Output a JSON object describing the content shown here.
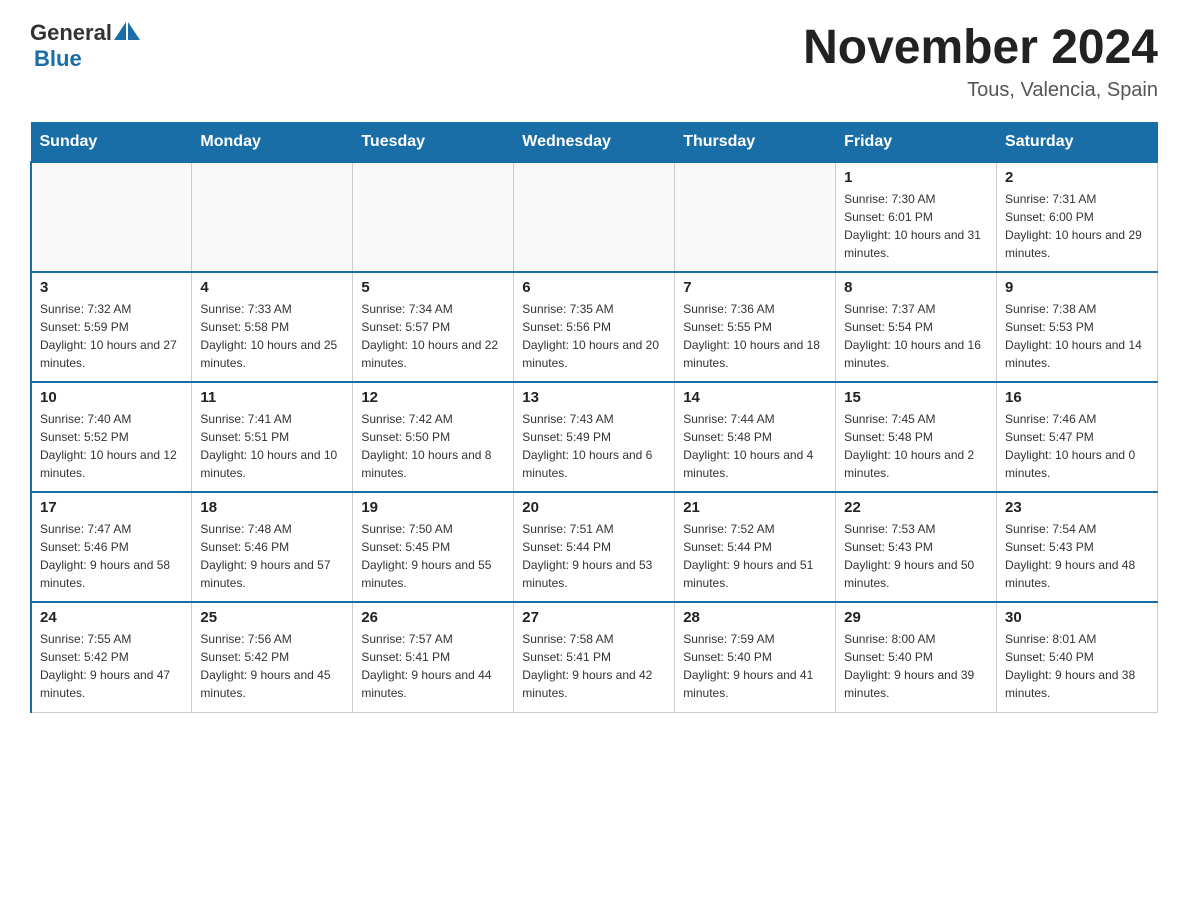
{
  "logo": {
    "text_general": "General",
    "text_blue": "Blue"
  },
  "title": "November 2024",
  "location": "Tous, Valencia, Spain",
  "days_of_week": [
    "Sunday",
    "Monday",
    "Tuesday",
    "Wednesday",
    "Thursday",
    "Friday",
    "Saturday"
  ],
  "weeks": [
    [
      {
        "day": "",
        "sunrise": "",
        "sunset": "",
        "daylight": ""
      },
      {
        "day": "",
        "sunrise": "",
        "sunset": "",
        "daylight": ""
      },
      {
        "day": "",
        "sunrise": "",
        "sunset": "",
        "daylight": ""
      },
      {
        "day": "",
        "sunrise": "",
        "sunset": "",
        "daylight": ""
      },
      {
        "day": "",
        "sunrise": "",
        "sunset": "",
        "daylight": ""
      },
      {
        "day": "1",
        "sunrise": "Sunrise: 7:30 AM",
        "sunset": "Sunset: 6:01 PM",
        "daylight": "Daylight: 10 hours and 31 minutes."
      },
      {
        "day": "2",
        "sunrise": "Sunrise: 7:31 AM",
        "sunset": "Sunset: 6:00 PM",
        "daylight": "Daylight: 10 hours and 29 minutes."
      }
    ],
    [
      {
        "day": "3",
        "sunrise": "Sunrise: 7:32 AM",
        "sunset": "Sunset: 5:59 PM",
        "daylight": "Daylight: 10 hours and 27 minutes."
      },
      {
        "day": "4",
        "sunrise": "Sunrise: 7:33 AM",
        "sunset": "Sunset: 5:58 PM",
        "daylight": "Daylight: 10 hours and 25 minutes."
      },
      {
        "day": "5",
        "sunrise": "Sunrise: 7:34 AM",
        "sunset": "Sunset: 5:57 PM",
        "daylight": "Daylight: 10 hours and 22 minutes."
      },
      {
        "day": "6",
        "sunrise": "Sunrise: 7:35 AM",
        "sunset": "Sunset: 5:56 PM",
        "daylight": "Daylight: 10 hours and 20 minutes."
      },
      {
        "day": "7",
        "sunrise": "Sunrise: 7:36 AM",
        "sunset": "Sunset: 5:55 PM",
        "daylight": "Daylight: 10 hours and 18 minutes."
      },
      {
        "day": "8",
        "sunrise": "Sunrise: 7:37 AM",
        "sunset": "Sunset: 5:54 PM",
        "daylight": "Daylight: 10 hours and 16 minutes."
      },
      {
        "day": "9",
        "sunrise": "Sunrise: 7:38 AM",
        "sunset": "Sunset: 5:53 PM",
        "daylight": "Daylight: 10 hours and 14 minutes."
      }
    ],
    [
      {
        "day": "10",
        "sunrise": "Sunrise: 7:40 AM",
        "sunset": "Sunset: 5:52 PM",
        "daylight": "Daylight: 10 hours and 12 minutes."
      },
      {
        "day": "11",
        "sunrise": "Sunrise: 7:41 AM",
        "sunset": "Sunset: 5:51 PM",
        "daylight": "Daylight: 10 hours and 10 minutes."
      },
      {
        "day": "12",
        "sunrise": "Sunrise: 7:42 AM",
        "sunset": "Sunset: 5:50 PM",
        "daylight": "Daylight: 10 hours and 8 minutes."
      },
      {
        "day": "13",
        "sunrise": "Sunrise: 7:43 AM",
        "sunset": "Sunset: 5:49 PM",
        "daylight": "Daylight: 10 hours and 6 minutes."
      },
      {
        "day": "14",
        "sunrise": "Sunrise: 7:44 AM",
        "sunset": "Sunset: 5:48 PM",
        "daylight": "Daylight: 10 hours and 4 minutes."
      },
      {
        "day": "15",
        "sunrise": "Sunrise: 7:45 AM",
        "sunset": "Sunset: 5:48 PM",
        "daylight": "Daylight: 10 hours and 2 minutes."
      },
      {
        "day": "16",
        "sunrise": "Sunrise: 7:46 AM",
        "sunset": "Sunset: 5:47 PM",
        "daylight": "Daylight: 10 hours and 0 minutes."
      }
    ],
    [
      {
        "day": "17",
        "sunrise": "Sunrise: 7:47 AM",
        "sunset": "Sunset: 5:46 PM",
        "daylight": "Daylight: 9 hours and 58 minutes."
      },
      {
        "day": "18",
        "sunrise": "Sunrise: 7:48 AM",
        "sunset": "Sunset: 5:46 PM",
        "daylight": "Daylight: 9 hours and 57 minutes."
      },
      {
        "day": "19",
        "sunrise": "Sunrise: 7:50 AM",
        "sunset": "Sunset: 5:45 PM",
        "daylight": "Daylight: 9 hours and 55 minutes."
      },
      {
        "day": "20",
        "sunrise": "Sunrise: 7:51 AM",
        "sunset": "Sunset: 5:44 PM",
        "daylight": "Daylight: 9 hours and 53 minutes."
      },
      {
        "day": "21",
        "sunrise": "Sunrise: 7:52 AM",
        "sunset": "Sunset: 5:44 PM",
        "daylight": "Daylight: 9 hours and 51 minutes."
      },
      {
        "day": "22",
        "sunrise": "Sunrise: 7:53 AM",
        "sunset": "Sunset: 5:43 PM",
        "daylight": "Daylight: 9 hours and 50 minutes."
      },
      {
        "day": "23",
        "sunrise": "Sunrise: 7:54 AM",
        "sunset": "Sunset: 5:43 PM",
        "daylight": "Daylight: 9 hours and 48 minutes."
      }
    ],
    [
      {
        "day": "24",
        "sunrise": "Sunrise: 7:55 AM",
        "sunset": "Sunset: 5:42 PM",
        "daylight": "Daylight: 9 hours and 47 minutes."
      },
      {
        "day": "25",
        "sunrise": "Sunrise: 7:56 AM",
        "sunset": "Sunset: 5:42 PM",
        "daylight": "Daylight: 9 hours and 45 minutes."
      },
      {
        "day": "26",
        "sunrise": "Sunrise: 7:57 AM",
        "sunset": "Sunset: 5:41 PM",
        "daylight": "Daylight: 9 hours and 44 minutes."
      },
      {
        "day": "27",
        "sunrise": "Sunrise: 7:58 AM",
        "sunset": "Sunset: 5:41 PM",
        "daylight": "Daylight: 9 hours and 42 minutes."
      },
      {
        "day": "28",
        "sunrise": "Sunrise: 7:59 AM",
        "sunset": "Sunset: 5:40 PM",
        "daylight": "Daylight: 9 hours and 41 minutes."
      },
      {
        "day": "29",
        "sunrise": "Sunrise: 8:00 AM",
        "sunset": "Sunset: 5:40 PM",
        "daylight": "Daylight: 9 hours and 39 minutes."
      },
      {
        "day": "30",
        "sunrise": "Sunrise: 8:01 AM",
        "sunset": "Sunset: 5:40 PM",
        "daylight": "Daylight: 9 hours and 38 minutes."
      }
    ]
  ]
}
